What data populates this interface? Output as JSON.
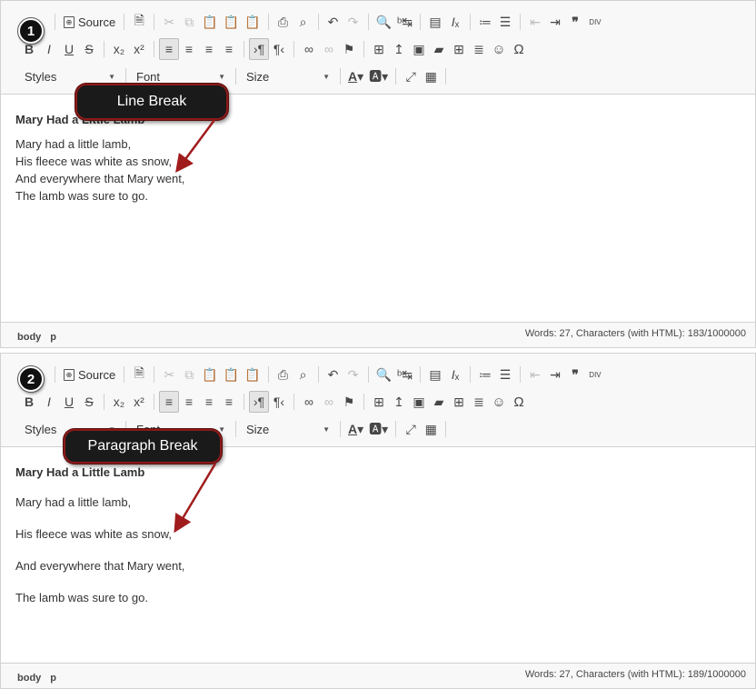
{
  "toolbar": {
    "source_label": "Source",
    "styles_label": "Styles",
    "font_label": "Font",
    "size_label": "Size",
    "div_label": "DIV"
  },
  "editors": [
    {
      "step_number": "1",
      "callout": "Line Break",
      "heading": "Mary Had a Little Lamb",
      "lines": [
        "Mary had a little lamb,",
        "His fleece was white as snow,",
        "And everywhere that Mary went,",
        "The lamb was sure to go."
      ],
      "path": [
        "body",
        "p"
      ],
      "count": "Words: 27, Characters (with HTML): 183/1000000"
    },
    {
      "step_number": "2",
      "callout": "Paragraph Break",
      "heading": "Mary Had a Little Lamb",
      "lines": [
        "Mary had a little lamb,",
        "His fleece was white as snow,",
        "And everywhere that Mary went,",
        "The lamb was sure to go."
      ],
      "path": [
        "body",
        "p"
      ],
      "count": "Words: 27, Characters (with HTML): 189/1000000"
    }
  ],
  "colors": {
    "callout_border": "#8b1a1a",
    "arrow": "#a01c1c"
  }
}
